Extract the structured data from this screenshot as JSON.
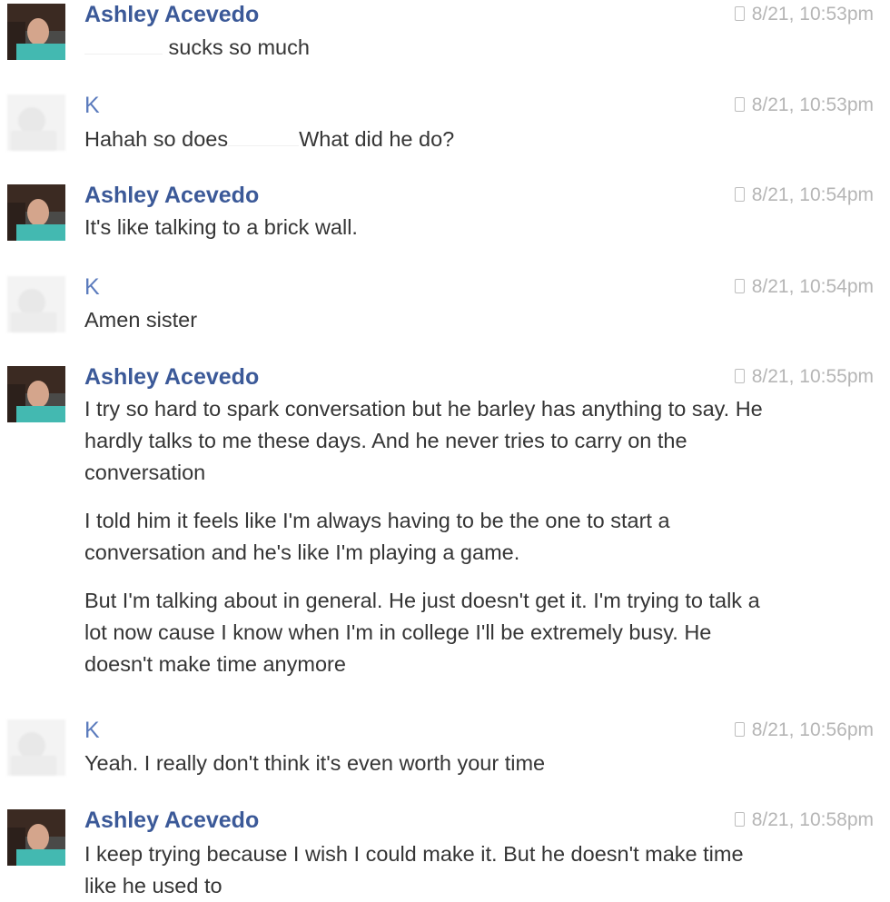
{
  "messages": [
    {
      "sender": "Ashley Acevedo",
      "timestamp": "8/21, 10:53pm",
      "avatar": "profile-photo",
      "text_suffix": "sucks so much"
    },
    {
      "sender": "K",
      "timestamp": "8/21, 10:53pm",
      "avatar": "blurred-photo",
      "text_prefix": "Hahah so does",
      "text_suffix": "What did he do?"
    },
    {
      "sender": "Ashley Acevedo",
      "timestamp": "8/21, 10:54pm",
      "avatar": "profile-photo",
      "text": "It's like talking to a brick wall."
    },
    {
      "sender": "K",
      "timestamp": "8/21, 10:54pm",
      "avatar": "blurred-photo",
      "text": "Amen sister"
    },
    {
      "sender": "Ashley Acevedo",
      "timestamp": "8/21, 10:55pm",
      "avatar": "profile-photo",
      "paragraphs": [
        "I try so hard to spark conversation but he barley has anything to say. He hardly talks to me these days. And he never tries to carry on the conversation",
        "I told him it feels like I'm always having to be the one to start a conversation and he's like I'm playing a game.",
        "But I'm talking about in general. He just doesn't get it. I'm trying to talk a lot now cause I know when I'm in college I'll be extremely busy. He doesn't make time anymore"
      ]
    },
    {
      "sender": "K",
      "timestamp": "8/21, 10:56pm",
      "avatar": "blurred-photo",
      "text": "Yeah. I really don't think it's even worth your time"
    },
    {
      "sender": "Ashley Acevedo",
      "timestamp": "8/21, 10:58pm",
      "avatar": "profile-photo",
      "text": "I keep trying because I wish I could make it. But he doesn't make time like he used to"
    }
  ],
  "icons": {
    "timestamp_icon": "mobile-phone-icon"
  },
  "colors": {
    "sender_name": "#3b5998",
    "timestamp": "#b5b5b5",
    "body_text": "#353535"
  }
}
